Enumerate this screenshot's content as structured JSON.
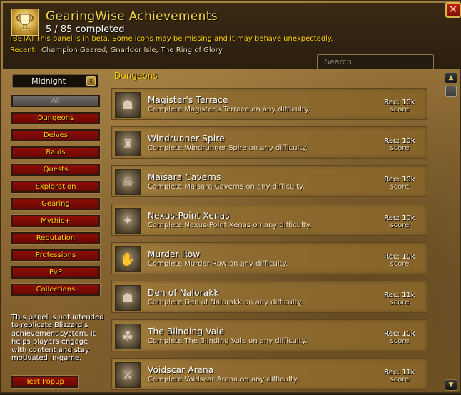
{
  "header": {
    "title": "GearingWise Achievements",
    "completed": "5 / 85 completed",
    "beta_notice": "[BETA] This panel is in beta. Some icons may be missing and it may behave unexpectedly.",
    "recent_label": "Recent:",
    "recent_value": "Champion Geared, Gnarldor Isle, The Ring of Glory",
    "close_glyph": "✕",
    "logo_icon": "trophy-cup-icon"
  },
  "search": {
    "placeholder": "Search..."
  },
  "sidebar": {
    "expansion_selected": "Midnight",
    "dropdown_arrow": "⬍",
    "categories": [
      "All",
      "Dungeons",
      "Delves",
      "Raids",
      "Quests",
      "Exploration",
      "Gearing",
      "Mythic+",
      "Reputation",
      "Professions",
      "PvP",
      "Collections"
    ],
    "note": "This panel is not intended to replicate Blizzard's achievement system. It helps players engage with content and stay motivated in-game.",
    "test_popup": "Test Popup"
  },
  "main": {
    "section_title": "Dungeons",
    "rows": [
      {
        "name": "Magister's Terrace",
        "desc": "Complete Magister's Terrace on any difficulty.",
        "rec": "Rec: 10k",
        "score": "score",
        "glyph": "☗"
      },
      {
        "name": "Windrunner Spire",
        "desc": "Complete Windrunner Spire on any difficulty.",
        "rec": "Rec: 10k",
        "score": "score",
        "glyph": "♜"
      },
      {
        "name": "Maisara Caverns",
        "desc": "Complete Maisara Caverns on any difficulty.",
        "rec": "Rec: 10k",
        "score": "score",
        "glyph": "☠"
      },
      {
        "name": "Nexus-Point Xenas",
        "desc": "Complete Nexus-Point Xenas on any difficulty.",
        "rec": "Rec: 10k",
        "score": "score",
        "glyph": "✦"
      },
      {
        "name": "Murder Row",
        "desc": "Complete Murder Row on any difficulty.",
        "rec": "Rec: 10k",
        "score": "score",
        "glyph": "✋"
      },
      {
        "name": "Den of Nalorakk",
        "desc": "Complete Den of Nalorakk on any difficulty.",
        "rec": "Rec: 11k",
        "score": "score",
        "glyph": "☗"
      },
      {
        "name": "The Blinding Vale",
        "desc": "Complete The Blinding Vale on any difficulty.",
        "rec": "Rec: 10k",
        "score": "score",
        "glyph": "☘"
      },
      {
        "name": "Voidscar Arena",
        "desc": "Complete Voidscar Arena on any difficulty.",
        "rec": "Rec: 11k",
        "score": "score",
        "glyph": "⚔"
      }
    ]
  },
  "scrollbar": {
    "up_glyph": "▲",
    "down_glyph": "▼"
  }
}
